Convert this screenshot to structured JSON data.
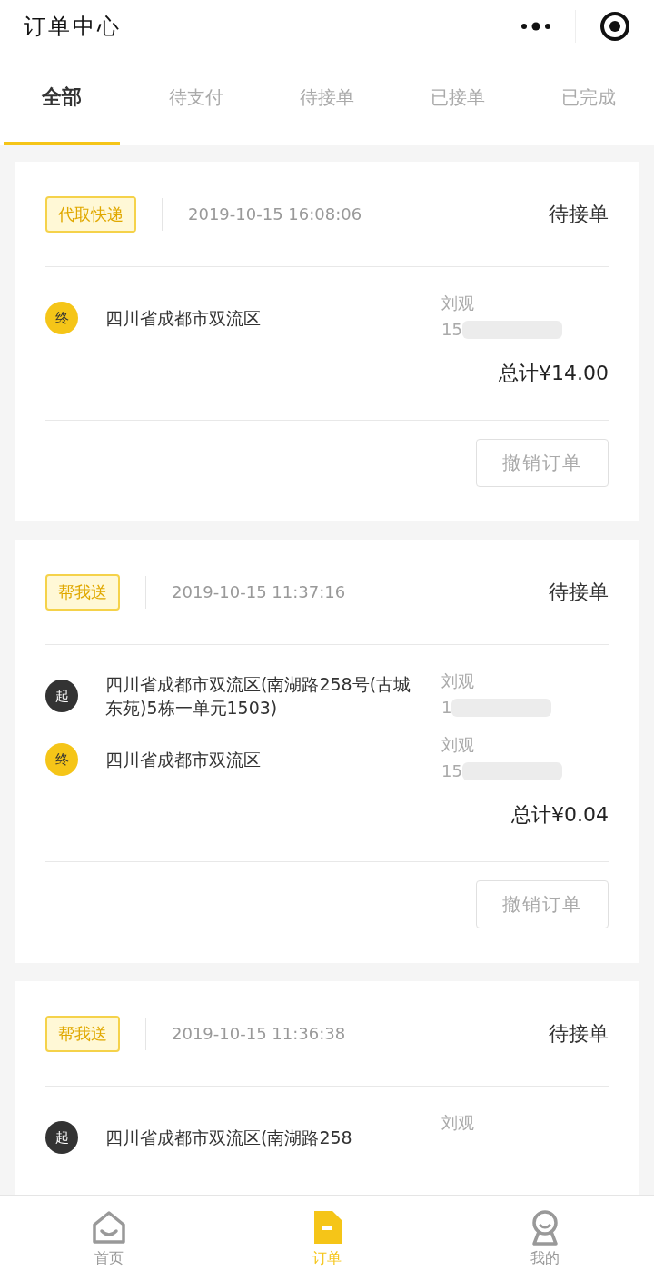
{
  "header": {
    "title": "订单中心"
  },
  "tabs": [
    {
      "label": "全部",
      "selected": true
    },
    {
      "label": "待支付",
      "selected": false
    },
    {
      "label": "待接单",
      "selected": false
    },
    {
      "label": "已接单",
      "selected": false
    },
    {
      "label": "已完成",
      "selected": false
    }
  ],
  "orders": [
    {
      "tag": "代取快递",
      "time": "2019-10-15 16:08:06",
      "status": "待接单",
      "stops": [
        {
          "kind": "end",
          "marker": "终",
          "address": "四川省成都市双流区",
          "name": "刘观",
          "phone": "15"
        }
      ],
      "total": "总计¥14.00",
      "action": "撤销订单"
    },
    {
      "tag": "帮我送",
      "time": "2019-10-15 11:37:16",
      "status": "待接单",
      "stops": [
        {
          "kind": "start",
          "marker": "起",
          "address": "四川省成都市双流区(南湖路258号(古城东苑)5栋一单元1503)",
          "name": "刘观",
          "phone": "1"
        },
        {
          "kind": "end",
          "marker": "终",
          "address": "四川省成都市双流区",
          "name": "刘观",
          "phone": "15"
        }
      ],
      "total": "总计¥0.04",
      "action": "撤销订单"
    },
    {
      "tag": "帮我送",
      "time": "2019-10-15 11:36:38",
      "status": "待接单",
      "stops": [
        {
          "kind": "start",
          "marker": "起",
          "address": "四川省成都市双流区(南湖路258",
          "name": "刘观"
        }
      ]
    }
  ],
  "nav": [
    {
      "kind": "home",
      "label": "首页",
      "selected": false
    },
    {
      "kind": "orders",
      "label": "订单",
      "selected": true
    },
    {
      "kind": "profile",
      "label": "我的",
      "selected": false
    }
  ]
}
